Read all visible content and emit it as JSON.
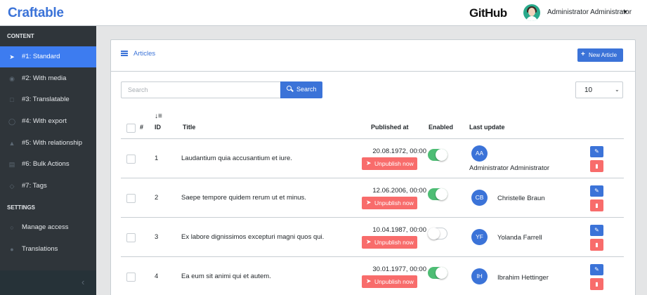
{
  "header": {
    "brand": "Craftable",
    "github": "GitHub",
    "user": "Administrator Administrator"
  },
  "sidebar": {
    "sections": [
      "CONTENT",
      "SETTINGS"
    ],
    "items": [
      {
        "label": "#1: Standard",
        "icon": "rocket-icon",
        "active": true
      },
      {
        "label": "#2: With media",
        "icon": "globe-icon"
      },
      {
        "label": "#3: Translatable",
        "icon": "lock-icon"
      },
      {
        "label": "#4: With export",
        "icon": "drop-icon"
      },
      {
        "label": "#5: With relationship",
        "icon": "graduation-cap-icon"
      },
      {
        "label": "#6: Bulk Actions",
        "icon": "news-icon"
      },
      {
        "label": "#7: Tags",
        "icon": "tag-icon"
      },
      {
        "label": "Manage access",
        "icon": "user-icon"
      },
      {
        "label": "Translations",
        "icon": "location-pin-icon"
      }
    ],
    "colors": {
      "active": "#3d7cf0",
      "background": "#2f353a"
    }
  },
  "card": {
    "title": "Articles",
    "new_button": "New Article",
    "search_placeholder": "Search",
    "search_button": "Search",
    "per_page": "10"
  },
  "table": {
    "columns": [
      "#",
      "ID",
      "Title",
      "Published at",
      "Enabled",
      "Last update"
    ],
    "unpublish_label": "Unpublish now",
    "rows": [
      {
        "id": "1",
        "title": "Laudantium quia accusantium et iure.",
        "published": "20.08.1972, 00:00",
        "enabled": true,
        "initials": "AA",
        "updated_by": "Administrator Administrator"
      },
      {
        "id": "2",
        "title": "Saepe tempore quidem rerum ut et minus.",
        "published": "12.06.2006, 00:00",
        "enabled": true,
        "initials": "CB",
        "updated_by": "Christelle Braun"
      },
      {
        "id": "3",
        "title": "Ex labore dignissimos excepturi magni quos qui.",
        "published": "10.04.1987, 00:00",
        "enabled": false,
        "initials": "YF",
        "updated_by": "Yolanda Farrell"
      },
      {
        "id": "4",
        "title": "Ea eum sit animi qui et autem.",
        "published": "30.01.1977, 00:00",
        "enabled": true,
        "initials": "IH",
        "updated_by": "Ibrahim Hettinger"
      }
    ]
  }
}
